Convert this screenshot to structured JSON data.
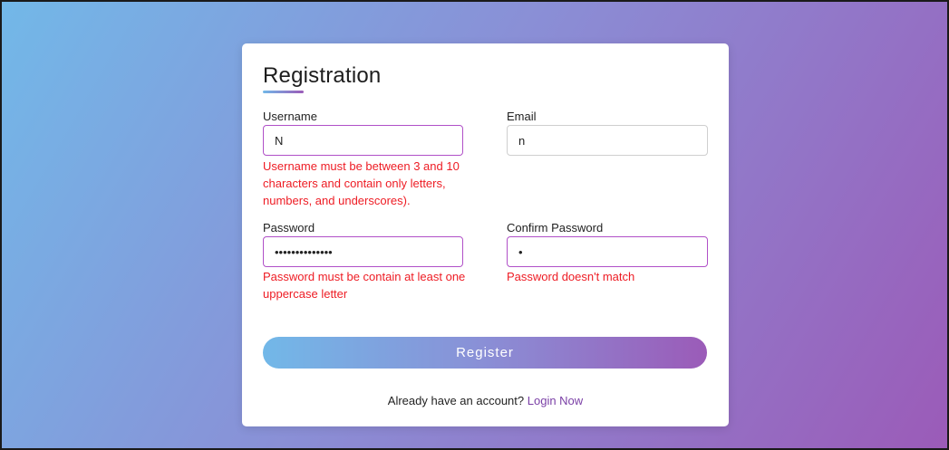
{
  "form": {
    "title": "Registration",
    "username": {
      "label": "Username",
      "value": "N",
      "error": "Username must be between 3 and 10 characters and contain only letters, numbers, and underscores)."
    },
    "email": {
      "label": "Email",
      "value": "n"
    },
    "password": {
      "label": "Password",
      "value": "••••••••••••••",
      "error": "Password must be contain at least one uppercase letter"
    },
    "confirm_password": {
      "label": "Confirm Password",
      "value": "•",
      "error": "Password doesn't match"
    },
    "submit_label": "Register",
    "footer_text": "Already have an account?",
    "login_link": "Login Now"
  },
  "colors": {
    "gradient_start": "#72b8e8",
    "gradient_end": "#9b5bb8",
    "error": "#ee1c24",
    "link": "#7a3fa6"
  }
}
